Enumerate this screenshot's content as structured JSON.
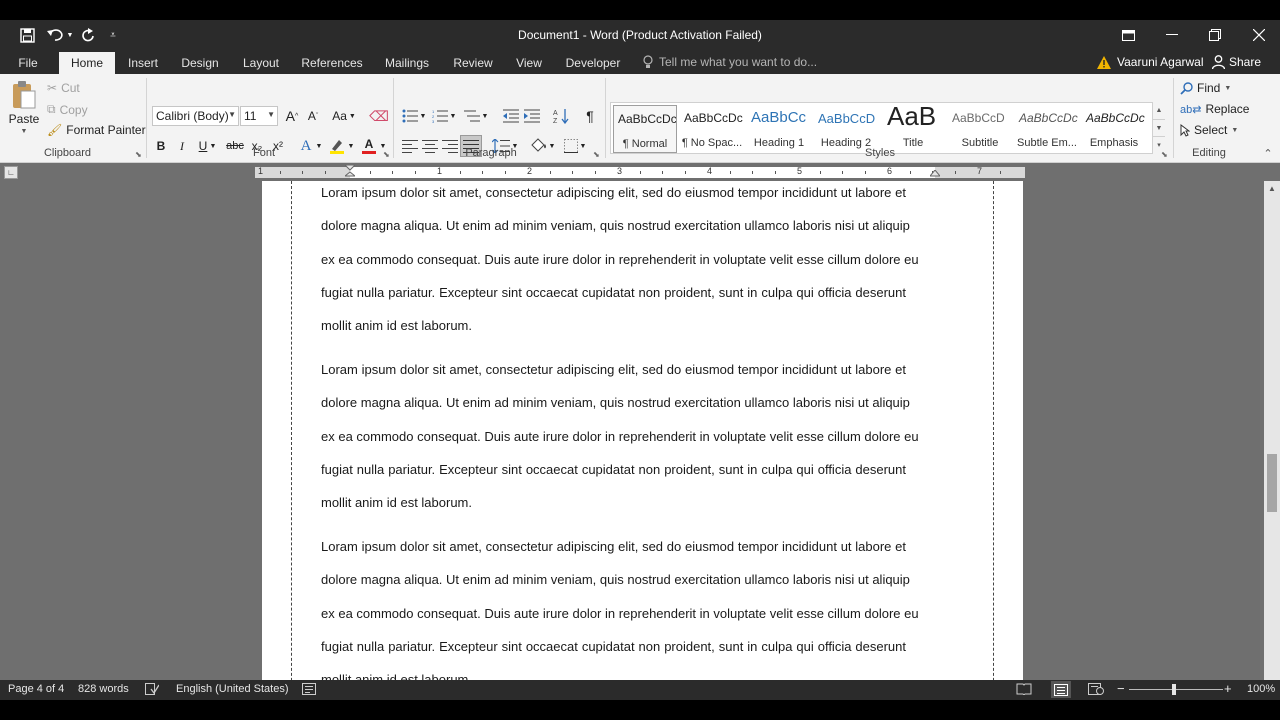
{
  "window": {
    "title": "Document1 - Word (Product Activation Failed)",
    "qat": {
      "save_icon": "save-icon",
      "undo_icon": "undo-icon",
      "redo_icon": "repeat-icon",
      "customize_icon": "customize-qat-icon"
    },
    "controls": {
      "ribbon_options": "ribbon-display-options-icon",
      "minimize": "minimize-icon",
      "restore": "restore-icon",
      "close": "close-icon"
    }
  },
  "tabs": [
    {
      "label": "File"
    },
    {
      "label": "Home"
    },
    {
      "label": "Insert"
    },
    {
      "label": "Design"
    },
    {
      "label": "Layout"
    },
    {
      "label": "References"
    },
    {
      "label": "Mailings"
    },
    {
      "label": "Review"
    },
    {
      "label": "View"
    },
    {
      "label": "Developer"
    }
  ],
  "tell_me": "Tell me what you want to do...",
  "user": {
    "name": "Vaaruni Agarwal",
    "warning_icon": "warning-icon"
  },
  "share_label": "Share",
  "clipboard": {
    "group": "Clipboard",
    "paste": "Paste",
    "cut": "Cut",
    "copy": "Copy",
    "format_painter": "Format Painter"
  },
  "font": {
    "group": "Font",
    "family": "Calibri (Body)",
    "size": "11",
    "grow": "A",
    "shrink": "A",
    "change_case": "Aa",
    "bold": "B",
    "italic": "I",
    "underline": "U",
    "strike": "abc",
    "subscript": "x₂",
    "superscript": "x²",
    "color_a": "A"
  },
  "paragraph": {
    "group": "Paragraph",
    "pilcrow": "¶"
  },
  "styles": {
    "group": "Styles",
    "items": [
      {
        "preview": "AaBbCcDc",
        "name": "¶ Normal"
      },
      {
        "preview": "AaBbCcDc",
        "name": "¶ No Spac..."
      },
      {
        "preview": "AaBbCc",
        "name": "Heading 1"
      },
      {
        "preview": "AaBbCcD",
        "name": "Heading 2"
      },
      {
        "preview": "AaB",
        "name": "Title"
      },
      {
        "preview": "AaBbCcD",
        "name": "Subtitle"
      },
      {
        "preview": "AaBbCcDc",
        "name": "Subtle Em..."
      },
      {
        "preview": "AaBbCcDc",
        "name": "Emphasis"
      }
    ]
  },
  "editing": {
    "group": "Editing",
    "find": "Find",
    "replace": "Replace",
    "select": "Select"
  },
  "ruler": {
    "numbers": [
      "1",
      "1",
      "2",
      "3",
      "4",
      "5",
      "6",
      "7"
    ]
  },
  "document": {
    "paragraphs": [
      {
        "lines": [
          "Loram ipsum dolor sit amet, consectetur adipiscing elit, sed do eiusmod tempor incididunt ut labore et",
          "dolore magna aliqua. Ut enim ad minim veniam, quis nostrud exercitation ullamco laboris nisi ut aliquip",
          "ex ea commodo consequat. Duis aute irure dolor in reprehenderit in voluptate velit esse cillum dolore eu",
          "fugiat nulla pariatur. Excepteur sint occaecat cupidatat non proident, sunt in culpa qui officia deserunt",
          "mollit anim id est laborum."
        ]
      },
      {
        "lines": [
          "Loram ipsum dolor sit amet, consectetur adipiscing elit, sed do eiusmod tempor incididunt ut labore et",
          "dolore magna aliqua. Ut enim ad minim veniam, quis nostrud exercitation ullamco laboris nisi ut aliquip",
          "ex ea commodo consequat. Duis aute irure dolor in reprehenderit in voluptate velit esse cillum dolore eu",
          "fugiat nulla pariatur. Excepteur sint occaecat cupidatat non proident, sunt in culpa qui officia deserunt",
          "mollit anim id est laborum."
        ]
      },
      {
        "lines": [
          "Loram ipsum dolor sit amet, consectetur adipiscing elit, sed do eiusmod tempor incididunt ut labore et",
          "dolore magna aliqua. Ut enim ad minim veniam, quis nostrud exercitation ullamco laboris nisi ut aliquip",
          "ex ea commodo consequat. Duis aute irure dolor in reprehenderit in voluptate velit esse cillum dolore eu",
          "fugiat nulla pariatur. Excepteur sint occaecat cupidatat non proident, sunt in culpa qui officia deserunt",
          "mollit anim id est laborum."
        ]
      }
    ]
  },
  "status": {
    "page": "Page 4 of 4",
    "words": "828 words",
    "language": "English (United States)",
    "zoom": "100%",
    "zoom_minus": "−",
    "zoom_plus": "+"
  }
}
